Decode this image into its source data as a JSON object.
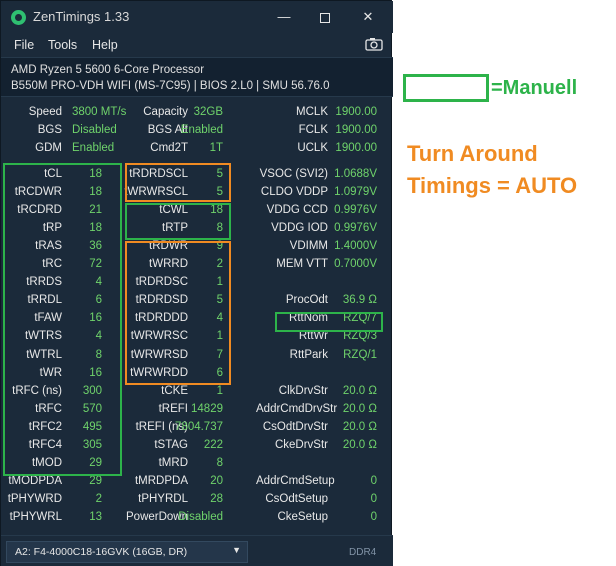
{
  "window": {
    "title": "ZenTimings 1.33",
    "controls": {
      "minimize": "—",
      "close": "✕"
    },
    "menu": [
      "File",
      "Tools",
      "Help"
    ],
    "screenshot_icon": "camera-icon"
  },
  "system": {
    "cpu": "AMD Ryzen 5 5600 6-Core Processor",
    "board": "B550M PRO-VDH WIFI (MS-7C95) | BIOS 2.L0 | SMU 56.76.0"
  },
  "top_rows": [
    {
      "l1": "Speed",
      "v1": "3800 MT/s",
      "l2": "Capacity",
      "v2": "32GB",
      "l3": "MCLK",
      "v3": "1900.00"
    },
    {
      "l1": "BGS",
      "v1": "Disabled",
      "l2": "BGS Alt",
      "v2": "Enabled",
      "l3": "FCLK",
      "v3": "1900.00"
    },
    {
      "l1": "GDM",
      "v1": "Enabled",
      "l2": "Cmd2T",
      "v2": "1T",
      "l3": "UCLK",
      "v3": "1900.00"
    }
  ],
  "timing_rows": [
    {
      "l1": "tCL",
      "v1": "18",
      "l2": "tRDRDSCL",
      "v2": "5",
      "l3": "VSOC (SVI2)",
      "v3": "1.0688V"
    },
    {
      "l1": "tRCDWR",
      "v1": "18",
      "l2": "tWRWRSCL",
      "v2": "5",
      "l3": "CLDO VDDP",
      "v3": "1.0979V"
    },
    {
      "l1": "tRCDRD",
      "v1": "21",
      "l2": "tCWL",
      "v2": "18",
      "l3": "VDDG CCD",
      "v3": "0.9976V"
    },
    {
      "l1": "tRP",
      "v1": "18",
      "l2": "tRTP",
      "v2": "8",
      "l3": "VDDG IOD",
      "v3": "0.9976V"
    },
    {
      "l1": "tRAS",
      "v1": "36",
      "l2": "tRDWR",
      "v2": "9",
      "l3": "VDIMM",
      "v3": "1.4000V"
    },
    {
      "l1": "tRC",
      "v1": "72",
      "l2": "tWRRD",
      "v2": "2",
      "l3": "MEM VTT",
      "v3": "0.7000V"
    },
    {
      "l1": "tRRDS",
      "v1": "4",
      "l2": "tRDRDSC",
      "v2": "1",
      "l3": "",
      "v3": ""
    },
    {
      "l1": "tRRDL",
      "v1": "6",
      "l2": "tRDRDSD",
      "v2": "5",
      "l3": "ProcOdt",
      "v3": "36.9 Ω"
    },
    {
      "l1": "tFAW",
      "v1": "16",
      "l2": "tRDRDDD",
      "v2": "4",
      "l3": "RttNom",
      "v3": "RZQ/7"
    },
    {
      "l1": "tWTRS",
      "v1": "4",
      "l2": "tWRWRSC",
      "v2": "1",
      "l3": "RttWr",
      "v3": "RZQ/3"
    },
    {
      "l1": "tWTRL",
      "v1": "8",
      "l2": "tWRWRSD",
      "v2": "7",
      "l3": "RttPark",
      "v3": "RZQ/1"
    },
    {
      "l1": "tWR",
      "v1": "16",
      "l2": "tWRWRDD",
      "v2": "6",
      "l3": "",
      "v3": ""
    },
    {
      "l1": "tRFC (ns)",
      "v1": "300",
      "l2": "tCKE",
      "v2": "1",
      "l3": "ClkDrvStr",
      "v3": "20.0 Ω"
    },
    {
      "l1": "tRFC",
      "v1": "570",
      "l2": "tREFI",
      "v2": "14829",
      "l3": "AddrCmdDrvStr",
      "v3": "20.0 Ω"
    },
    {
      "l1": "tRFC2",
      "v1": "495",
      "l2": "tREFI (ns)",
      "v2": "7804.737",
      "l3": "CsOdtDrvStr",
      "v3": "20.0 Ω"
    },
    {
      "l1": "tRFC4",
      "v1": "305",
      "l2": "tSTAG",
      "v2": "222",
      "l3": "CkeDrvStr",
      "v3": "20.0 Ω"
    },
    {
      "l1": "tMOD",
      "v1": "29",
      "l2": "tMRD",
      "v2": "8",
      "l3": "",
      "v3": ""
    },
    {
      "l1": "tMODPDA",
      "v1": "29",
      "l2": "tMRDPDA",
      "v2": "20",
      "l3": "AddrCmdSetup",
      "v3": "0"
    },
    {
      "l1": "tPHYWRD",
      "v1": "2",
      "l2": "tPHYRDL",
      "v2": "28",
      "l3": "CsOdtSetup",
      "v3": "0"
    },
    {
      "l1": "tPHYWRL",
      "v1": "13",
      "l2": "PowerDown",
      "v2": "Disabled",
      "l3": "CkeSetup",
      "v3": "0"
    }
  ],
  "statusbar": {
    "module_select": "A2: F4-4000C18-16GVK (16GB, DR)",
    "memory_type": "DDR4"
  },
  "annotations": {
    "manual_label": "=Manuell",
    "auto_label_line1": "Turn Around",
    "auto_label_line2": "Timings = AUTO"
  },
  "colors": {
    "manual": "#2db34a",
    "auto": "#f08b22",
    "value_text": "#6fd36b",
    "window_bg": "#1b2a3a"
  }
}
